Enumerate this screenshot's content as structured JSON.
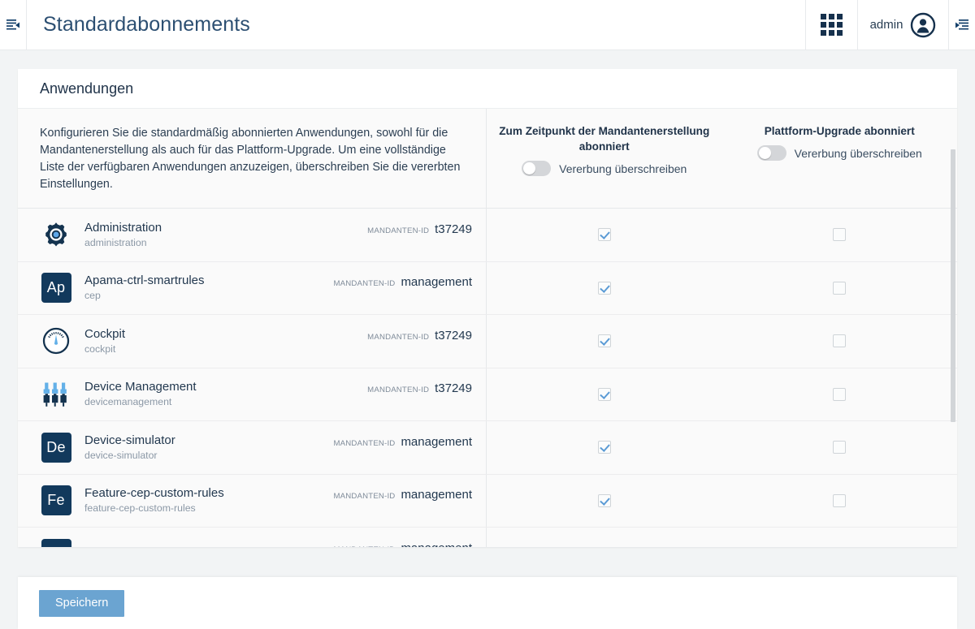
{
  "topbar": {
    "menu_icon": "menu-collapse-icon",
    "title": "Standardabonnements",
    "apps_icon": "apps-grid-icon",
    "user_label": "admin",
    "user_icon": "user-avatar-icon",
    "right_icon": "panel-collapse-icon"
  },
  "card": {
    "header_title": "Anwendungen",
    "description": "Konfigurieren Sie die standardmäßig abonnierten Anwendungen, sowohl für die Mandantenerstellung als auch für das Plattform-Upgrade. Um eine vollständige Liste der verfügbaren Anwendungen anzuzeigen, überschreiben Sie die vererbten Einstellungen.",
    "columns": [
      {
        "title": "Zum Zeitpunkt der Mandantenerstellung abonniert",
        "toggle_label": "Vererbung überschreiben",
        "toggle_on": false
      },
      {
        "title": "Plattform-Upgrade abonniert",
        "toggle_label": "Vererbung überschreiben",
        "toggle_on": false
      }
    ],
    "tenant_label": "MANDANTEN-ID",
    "rows": [
      {
        "name": "Administration",
        "key": "administration",
        "tenant": "t37249",
        "icon": "gear-icon",
        "icon_type": "gear",
        "col_a_checked": true,
        "col_b_checked": false
      },
      {
        "name": "Apama-ctrl-smartrules",
        "key": "cep",
        "tenant": "management",
        "icon": "letters-icon",
        "icon_type": "letters",
        "icon_text": "Ap",
        "col_a_checked": true,
        "col_b_checked": false
      },
      {
        "name": "Cockpit",
        "key": "cockpit",
        "tenant": "t37249",
        "icon": "gauge-icon",
        "icon_type": "gauge",
        "col_a_checked": true,
        "col_b_checked": false
      },
      {
        "name": "Device Management",
        "key": "devicemanagement",
        "tenant": "t37249",
        "icon": "devices-icon",
        "icon_type": "devices",
        "col_a_checked": true,
        "col_b_checked": false
      },
      {
        "name": "Device-simulator",
        "key": "device-simulator",
        "tenant": "management",
        "icon": "letters-icon",
        "icon_type": "letters",
        "icon_text": "De",
        "col_a_checked": true,
        "col_b_checked": false
      },
      {
        "name": "Feature-cep-custom-rules",
        "key": "feature-cep-custom-rules",
        "tenant": "management",
        "icon": "letters-icon",
        "icon_type": "letters",
        "icon_text": "Fe",
        "col_a_checked": true,
        "col_b_checked": false
      },
      {
        "name": "Feature-microservice-hosting",
        "key": "",
        "tenant": "management",
        "icon": "letters-icon",
        "icon_type": "letters",
        "icon_text": "Fe",
        "col_a_checked": true,
        "col_b_checked": false
      }
    ]
  },
  "footer": {
    "save_label": "Speichern"
  },
  "colors": {
    "accent": "#6ba4d1",
    "brand_dark": "#12395c",
    "title": "#2c4f72",
    "page_bg": "#f2f4f5"
  }
}
